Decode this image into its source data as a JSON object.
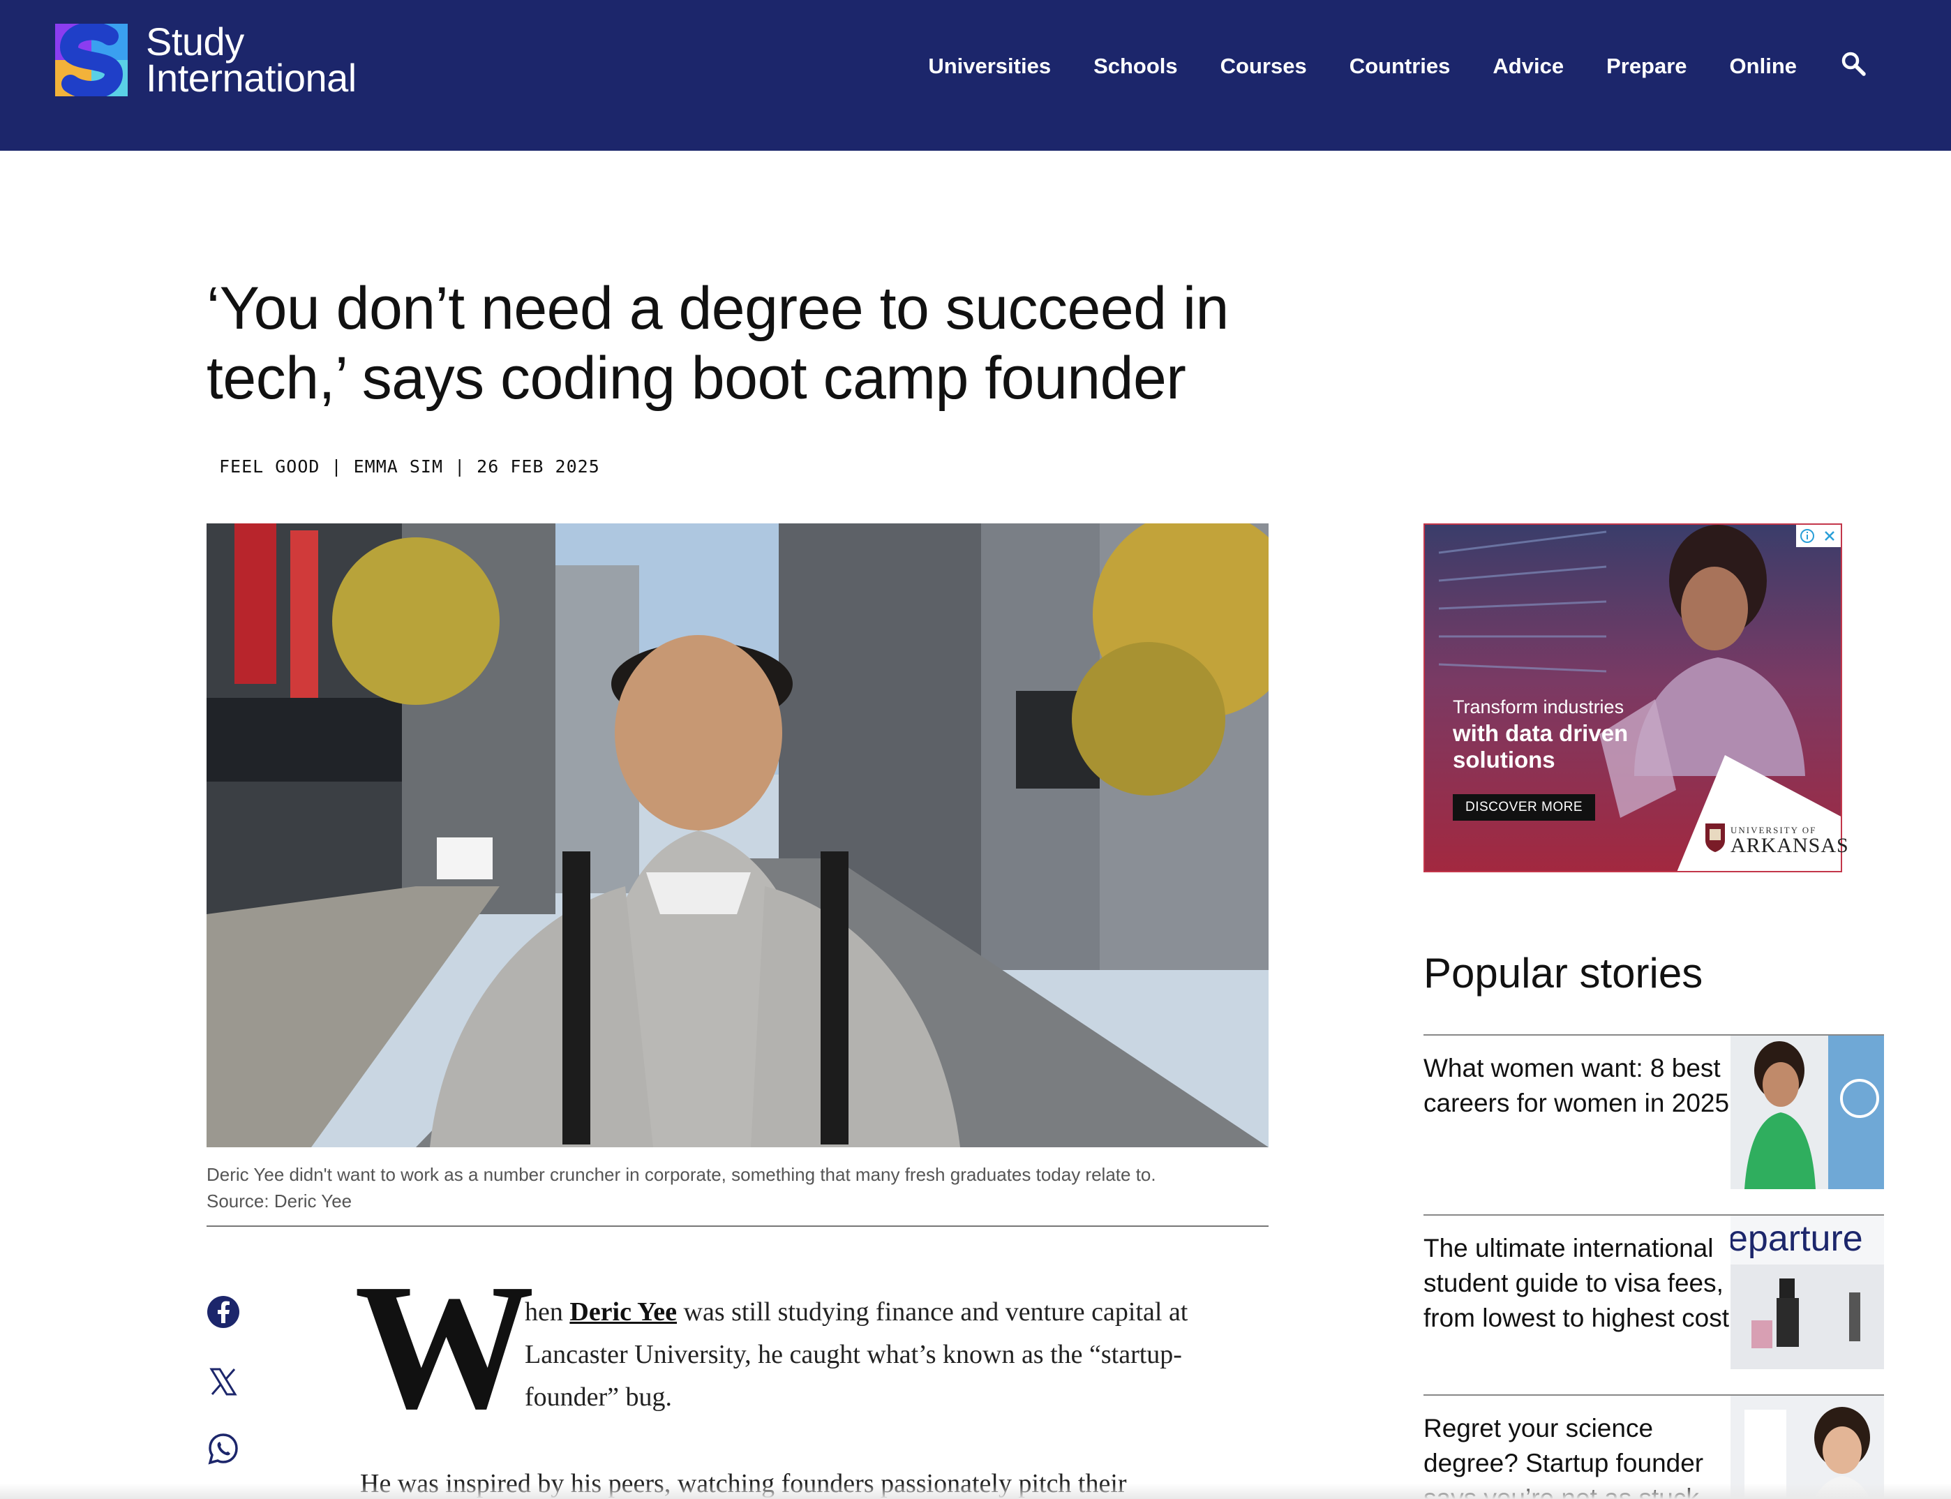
{
  "header": {
    "logo_line1": "Study",
    "logo_line2": "International",
    "nav": [
      "Universities",
      "Schools",
      "Courses",
      "Countries",
      "Advice",
      "Prepare",
      "Online"
    ],
    "search_icon": "search-icon",
    "background": "#1c266b"
  },
  "article": {
    "title": "‘You don’t need a degree to succeed in tech,’ says coding boot camp founder",
    "meta": "FEEL GOOD | EMMA SIM | 26 FEB 2025",
    "caption_line1": "Deric Yee didn't want to work as a number cruncher in corporate, something that many fresh graduates today relate to.",
    "caption_line2": "Source: Deric Yee",
    "dropcap": "W",
    "lead_before": "hen ",
    "lead_link": "Deric Yee",
    "lead_after": " was still studying finance and venture capital at Lancaster University, he caught what’s known as the “startup-founder” bug.",
    "para2": "He was inspired by his peers, watching founders passionately pitch their",
    "share": [
      "facebook-icon",
      "x-icon",
      "whatsapp-icon"
    ]
  },
  "ad": {
    "line1": "Transform industries",
    "line2": "with data driven solutions",
    "button": "DISCOVER MORE",
    "sponsor_small": "UNIVERSITY OF",
    "sponsor_big": "ARKANSAS",
    "accent": "#c3364a"
  },
  "sidebar": {
    "heading": "Popular stories",
    "stories": [
      {
        "title": "What women want: 8 best careers for women in 2025"
      },
      {
        "title": "The ultimate international student guide to visa fees, from lowest to highest cost",
        "thumb_text": "eparture"
      },
      {
        "title": "Regret your science degree? Startup founder says you’re not as stuck"
      }
    ]
  }
}
